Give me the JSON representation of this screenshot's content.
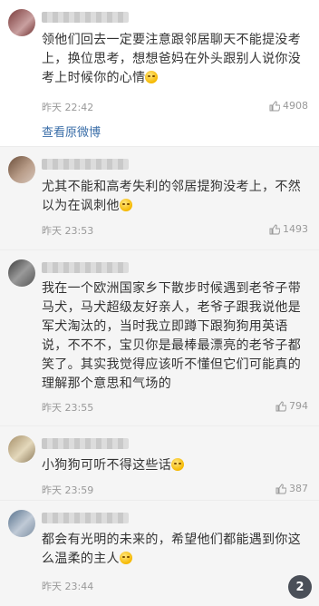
{
  "comments": [
    {
      "text": "领他们回去一定要注意跟邻居聊天不能提没考上，换位思考，想想爸妈在外头跟别人说你没考上时候你的心情",
      "time": "昨天 22:42",
      "likes": "4908",
      "link": "查看原微博"
    },
    {
      "text": "尤其不能和高考失利的邻居提狗没考上，不然以为在讽刺他",
      "time": "昨天 23:53",
      "likes": "1493"
    },
    {
      "text": "我在一个欧洲国家乡下散步时候遇到老爷子带马犬，马犬超级友好亲人，老爷子跟我说他是军犬淘汰的，当时我立即蹲下跟狗狗用英语说，不不不，宝贝你是最棒最漂亮的老爷子都笑了。其实我觉得应该听不懂但它们可能真的理解那个意思和气场的",
      "time": "昨天 23:55",
      "likes": "794"
    },
    {
      "text": "小狗狗可听不得这些话",
      "time": "昨天 23:59",
      "likes": "387"
    },
    {
      "text": "都会有光明的未来的，希望他们都能遇到你这么温柔的主人",
      "time": "昨天 23:44",
      "likes": ""
    }
  ],
  "page_badge": "2",
  "icons": {
    "like": "thumbs-up-icon",
    "emoji": "emoji-icon"
  }
}
